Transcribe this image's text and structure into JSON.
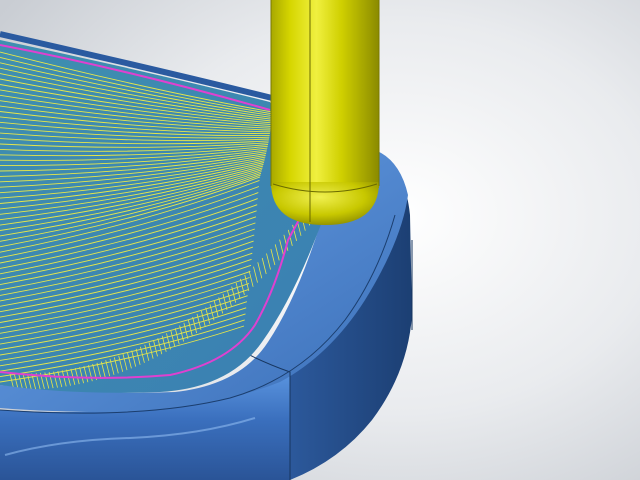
{
  "viewport": {
    "background_gradient": [
      "#ffffff",
      "#e9ebee",
      "#c9cdd3"
    ]
  },
  "workpiece": {
    "body_color": "#3b6fb8",
    "body_dark": "#1f4a85",
    "edge_color": "#17365f"
  },
  "toolpath": {
    "pass_color": "#e6e64a",
    "boundary_color": "#e040d0"
  },
  "tool": {
    "shank_color": "#d8d800",
    "shank_dark": "#9a9a00",
    "shank_light": "#f4f45a"
  }
}
